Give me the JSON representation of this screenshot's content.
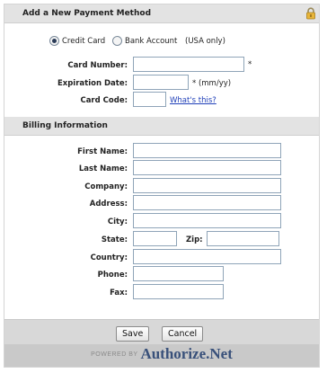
{
  "payment": {
    "section_title": "Add a New Payment Method",
    "method_credit": "Credit Card",
    "method_bank": "Bank Account",
    "method_bank_note": "(USA only)",
    "card_number_label": "Card Number:",
    "card_number_value": "",
    "card_number_required": "*",
    "expiration_label": "Expiration Date:",
    "expiration_value": "",
    "expiration_hint": "* (mm/yy)",
    "card_code_label": "Card Code:",
    "card_code_value": "",
    "whats_this": "What's this?"
  },
  "billing": {
    "section_title": "Billing Information",
    "first_name_label": "First Name:",
    "last_name_label": "Last Name:",
    "company_label": "Company:",
    "address_label": "Address:",
    "city_label": "City:",
    "state_label": "State:",
    "zip_label": "Zip:",
    "country_label": "Country:",
    "phone_label": "Phone:",
    "fax_label": "Fax:"
  },
  "footer": {
    "save_label": "Save",
    "cancel_label": "Cancel",
    "powered_by": "POWERED BY",
    "brand": "Authorize.Net"
  },
  "icons": {
    "lock": "lock-icon"
  },
  "colors": {
    "header_bg": "#e3e3e3",
    "link": "#1f3fb8",
    "brand": "#38507a",
    "input_border": "#8fa4b8"
  }
}
